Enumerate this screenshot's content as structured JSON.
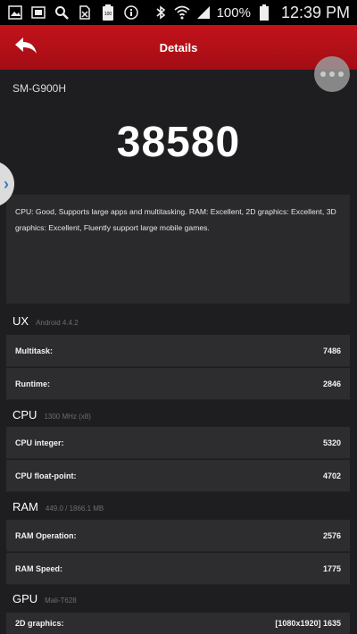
{
  "status_bar": {
    "icons": [
      "gallery-icon",
      "image-icon",
      "search-icon",
      "sim-off-icon",
      "battery-saver-icon",
      "info-icon",
      "bluetooth-icon",
      "wifi-icon",
      "signal-icon"
    ],
    "battery_pct": "100%",
    "time": "12:39 PM"
  },
  "header": {
    "title": "Details"
  },
  "device": {
    "name": "SM-G900H"
  },
  "score": "38580",
  "description": "CPU: Good, Supports large apps and multitasking. RAM: Excellent, 2D graphics: Excellent, 3D graphics: Excellent, Fluently support large mobile games.",
  "sections": {
    "ux": {
      "name": "UX",
      "sub": "Android 4.4.2",
      "rows": [
        {
          "label": "Multitask:",
          "value": "7486"
        },
        {
          "label": "Runtime:",
          "value": "2846"
        }
      ]
    },
    "cpu": {
      "name": "CPU",
      "sub": "1300 MHz (x8)",
      "rows": [
        {
          "label": "CPU integer:",
          "value": "5320"
        },
        {
          "label": "CPU float-point:",
          "value": "4702"
        }
      ]
    },
    "ram": {
      "name": "RAM",
      "sub": "449.0 / 1866.1 MB",
      "rows": [
        {
          "label": "RAM Operation:",
          "value": "2576"
        },
        {
          "label": "RAM Speed:",
          "value": "1775"
        }
      ]
    },
    "gpu": {
      "name": "GPU",
      "sub": "Mali-T628",
      "rows": [
        {
          "label": "2D graphics:",
          "value": "[1080x1920] 1635"
        }
      ]
    }
  },
  "colors": {
    "header_red": "#b5101a",
    "background": "#1e1e20",
    "row_bg": "#2d2d2f",
    "side_tab_arrow": "#3a7bbf"
  }
}
